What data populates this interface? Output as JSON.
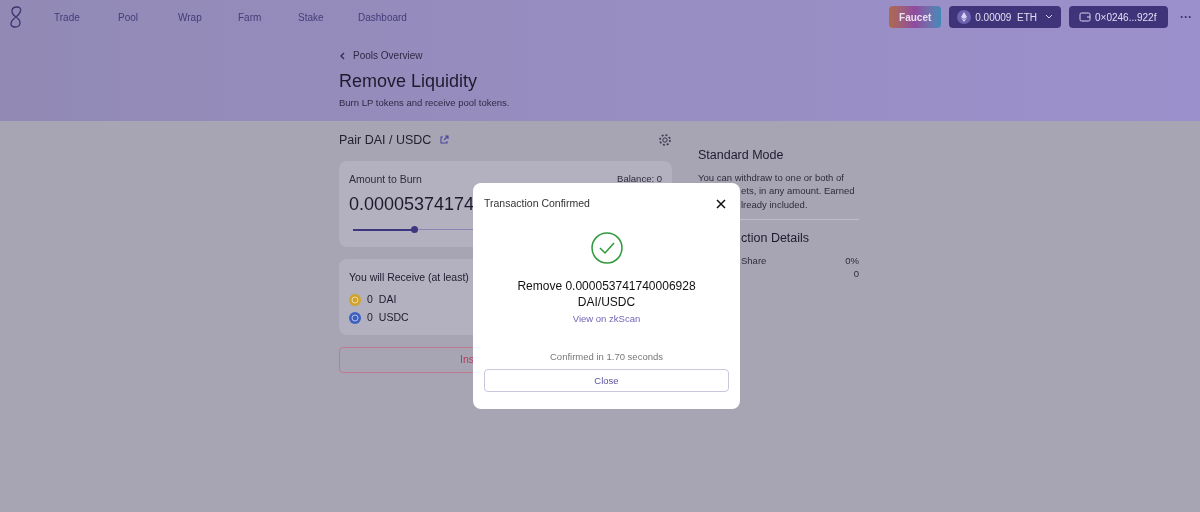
{
  "nav": {
    "items": [
      {
        "label": "Trade"
      },
      {
        "label": "Pool"
      },
      {
        "label": "Wrap"
      },
      {
        "label": "Farm"
      },
      {
        "label": "Stake"
      },
      {
        "label": "Dashboard"
      }
    ]
  },
  "header_actions": {
    "faucet": "Faucet",
    "balance": "0.00009  ETH",
    "account": "0×0246...922f",
    "more": "···"
  },
  "page": {
    "back": "Pools Overview",
    "title": "Remove Liquidity",
    "subtitle": "Burn LP tokens and receive pool tokens."
  },
  "pair": {
    "label": "Pair DAI / USDC"
  },
  "burn_card": {
    "label": "Amount to Burn",
    "balance": "Balance: 0",
    "amount": "0.00005374174",
    "level": 0.2
  },
  "receive_card": {
    "label": "You will Receive (at least)",
    "tokens": [
      {
        "amount": "0",
        "symbol": "DAI",
        "color": "#d1a32a"
      },
      {
        "amount": "0",
        "symbol": "USDC",
        "color": "#3d5fc0"
      }
    ]
  },
  "submit_button": {
    "label": "Ins"
  },
  "side_panel": {
    "title": "Standard Mode",
    "description_lines": [
      "You can withdraw to one or both of",
      "ets, in any amount. Earned",
      "lready included."
    ],
    "details_title": "ction Details",
    "rows": [
      {
        "label": "Share",
        "value": "0%"
      },
      {
        "label": "",
        "value": "0"
      }
    ]
  },
  "modal": {
    "title": "Transaction Confirmed",
    "message_lines": [
      "Remove 0.000053741740006928",
      "DAI/USDC"
    ],
    "link": "View on zkScan",
    "footer": "Confirmed in 1.70 seconds",
    "button": "Close"
  }
}
